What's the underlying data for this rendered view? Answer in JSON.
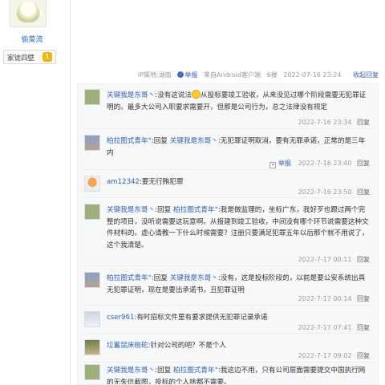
{
  "user": {
    "name": "偷菜流",
    "badge": "家徒四壁",
    "level": "1"
  },
  "post_meta": {
    "ip": "IP属地:湖南",
    "report": "举报",
    "client": "来自Android客户端",
    "floor": "6楼",
    "time": "2022-07-16 23:24",
    "collapse": "收起回复"
  },
  "replies": [
    {
      "author": "关键我是东哥丶",
      "text": ":没有这说法",
      "text_after": "从投标要竣工验收，从来没见过哪个阶段需要无犯罪证明的。最多大公司入职要求需要开，但那是公司行为，总之法律没有规定",
      "time": "2022-7-16 23:34",
      "reply": "回复"
    },
    {
      "author": "柏拉图式青年°",
      "prefix": ":回复",
      "target": "关键我是东哥丶",
      "text": ":无犯罪证明取消，要有无罪承诺，正常的是三年内",
      "report": "举报",
      "time": "2022-7-16 23:40",
      "reply": "回复"
    },
    {
      "author": "am12342",
      "text": ":要无行贿犯罪",
      "time": "2022-7-16 23:50",
      "reply": "回复"
    },
    {
      "author": "关键我是东哥丶",
      "prefix": ":回复",
      "target": "柏拉图式青年°",
      "text": ":我是做监理的，坐标广东，我好歹也跟过两个完整的项目，没听说需要这玩意啊。从报建到竣工验收，中间没有哪个环节说需要这种文件材料的。虚心请教一下什么时候需要？注册只要满足犯罪五年以后那个就不用说了，这个我清楚。",
      "time": "2022-7-17 00:11",
      "reply": "回复"
    },
    {
      "author": "柏拉图式青年°",
      "prefix": ":回复",
      "target": "关键我是东哥丶",
      "text": ":没有，这是投标阶段的，以前是要公安系统出具无犯罪证明，现在是要出承诺书，丑犯罪证明",
      "time": "2022-7-17 00:14",
      "reply": "回复"
    },
    {
      "author": "cser961",
      "text": ":有时招标文件里有要求提供无犯罪记录承诺",
      "time": "2022-7-17 07:41",
      "reply": "回复"
    },
    {
      "author": "垃蓄鼠床梳砣",
      "text": ":针对公司的吧？不是个人",
      "time": "2022-7-17 09:02",
      "reply": "回复"
    },
    {
      "author": "关键我是东哥丶",
      "prefix": ":回复",
      "target": "柏拉图式青年°",
      "text": ":我这边不用，只有公司层面需要提交中国执行网的无失信截图，投标的个人啥都不需要。"
    }
  ]
}
